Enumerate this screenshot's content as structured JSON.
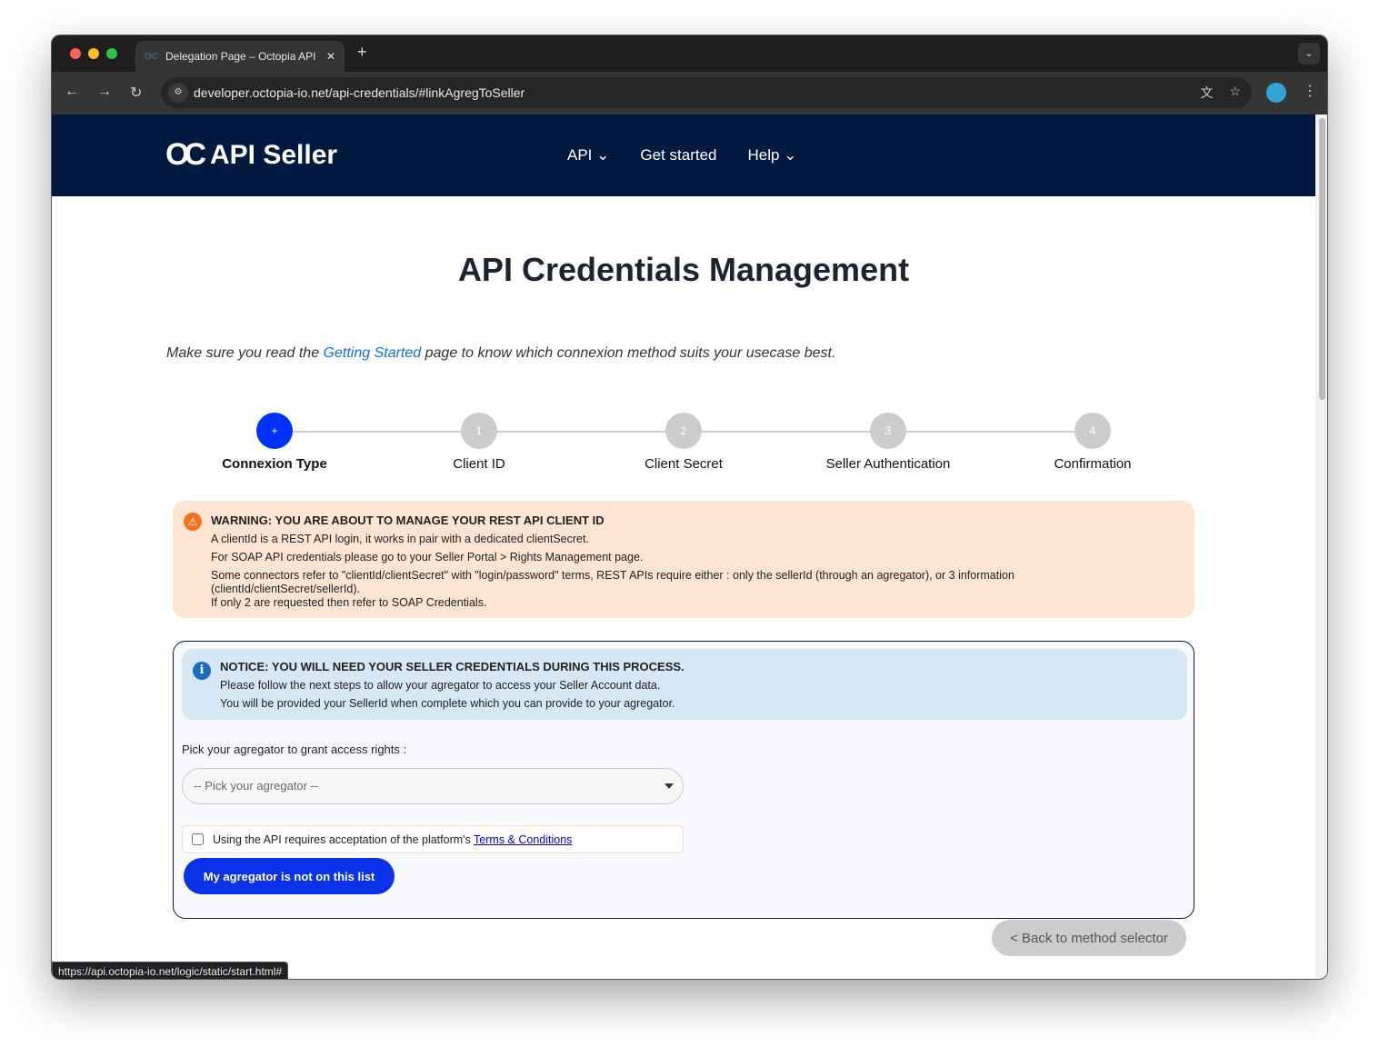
{
  "browser": {
    "tab_title": "Delegation Page – Octopia API",
    "tab_favicon": "OC",
    "url": "developer.octopia-io.net/api-credentials/#linkAgregToSeller",
    "status_url": "https://api.octopia-io.net/logic/static/start.html#"
  },
  "header": {
    "logo_mark": "OC",
    "brand": "API Seller",
    "menu": [
      {
        "label": "API"
      },
      {
        "label": "Get started"
      },
      {
        "label": "Help"
      }
    ]
  },
  "page": {
    "title": "API Credentials Management",
    "intro_before": "Make sure you read the ",
    "intro_link": "Getting Started",
    "intro_after": " page to know which connexion method suits your usecase best."
  },
  "steps": [
    {
      "num": "+",
      "label": "Connexion Type",
      "active": true
    },
    {
      "num": "1",
      "label": "Client ID"
    },
    {
      "num": "2",
      "label": "Client Secret"
    },
    {
      "num": "3",
      "label": "Seller Authentication"
    },
    {
      "num": "4",
      "label": "Confirmation"
    }
  ],
  "warning": {
    "title": "WARNING: YOU ARE ABOUT TO MANAGE YOUR REST API CLIENT ID",
    "lines": [
      "A clientId is a REST API login, it works in pair with a dedicated clientSecret.",
      "For SOAP API credentials please go to your Seller Portal > Rights Management page.",
      "Some connectors refer to \"clientId/clientSecret\" with \"login/password\" terms, REST APIs require either : only the sellerId (through an agregator), or 3 information (clientId/clientSecret/sellerId).",
      "If only 2 are requested then refer to SOAP Credentials."
    ]
  },
  "notice": {
    "title": "NOTICE: YOU WILL NEED YOUR SELLER CREDENTIALS DURING THIS PROCESS.",
    "lines": [
      "Please follow the next steps to allow your agregator to access your Seller Account data.",
      "You will be provided your SellerId when complete which you can provide to your agregator."
    ]
  },
  "form": {
    "pick_label": "Pick your agregator to grant access rights :",
    "select_placeholder": "-- Pick your agregator --",
    "terms_text": "Using the API requires acceptation of the platform's ",
    "terms_link": "Terms & Conditions",
    "not_listed_button": "My agregator is not on this list",
    "back_button": "< Back to method selector"
  }
}
